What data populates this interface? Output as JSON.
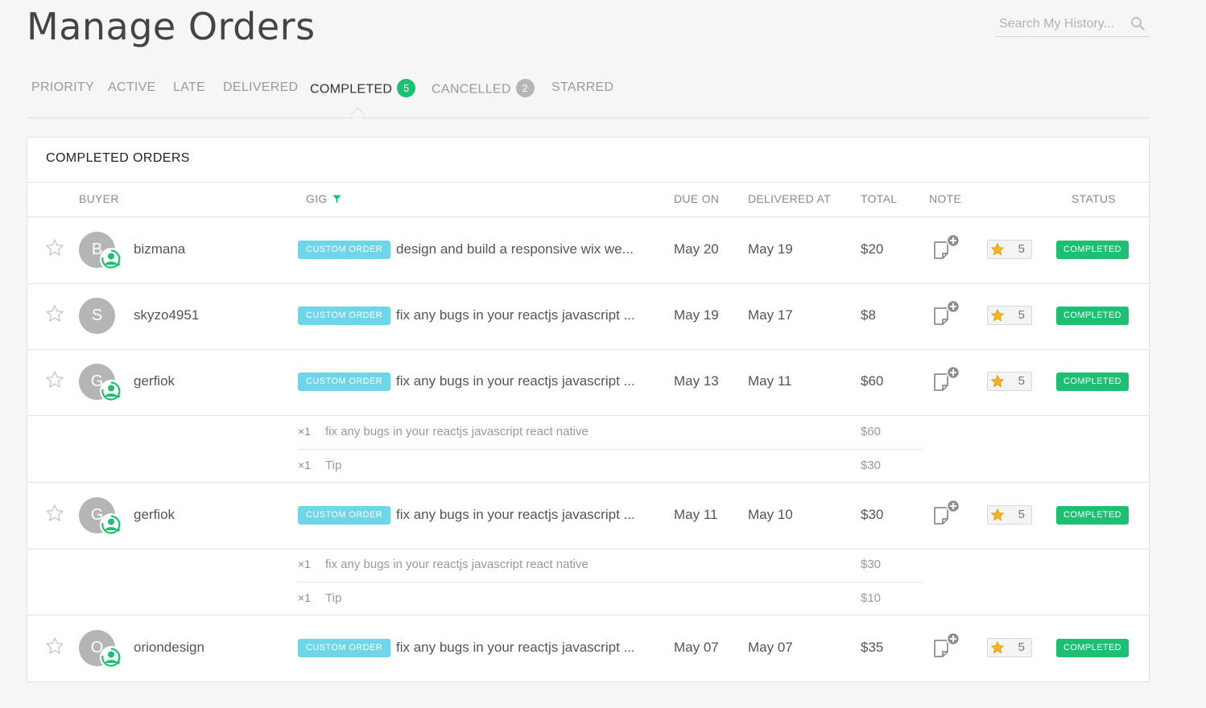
{
  "page": {
    "title": "Manage Orders"
  },
  "search": {
    "placeholder": "Search My History..."
  },
  "tabs": [
    {
      "label": "PRIORITY"
    },
    {
      "label": "ACTIVE"
    },
    {
      "label": "LATE"
    },
    {
      "label": "DELIVERED"
    },
    {
      "label": "COMPLETED",
      "badge": "5",
      "active": true
    },
    {
      "label": "CANCELLED",
      "badge": "2"
    },
    {
      "label": "STARRED"
    }
  ],
  "panel": {
    "title": "COMPLETED ORDERS",
    "columns": {
      "buyer": "BUYER",
      "gig": "GIG",
      "due_on": "DUE ON",
      "delivered_at": "DELIVERED AT",
      "total": "TOTAL",
      "note": "NOTE",
      "status": "STATUS"
    }
  },
  "orders": [
    {
      "avatar": "B",
      "buyer": "bizmana",
      "tag": "CUSTOM ORDER",
      "gig": "design and build a responsive wix we...",
      "due": "May 20",
      "delivered": "May 19",
      "total": "$20",
      "rating": "5",
      "status": "COMPLETED"
    },
    {
      "avatar": "S",
      "buyer": "skyzo4951",
      "tag": "CUSTOM ORDER",
      "gig": "fix any bugs in your reactjs javascript ...",
      "due": "May 19",
      "delivered": "May 17",
      "total": "$8",
      "rating": "5",
      "status": "COMPLETED"
    },
    {
      "avatar": "G",
      "buyer": "gerfiok",
      "tag": "CUSTOM ORDER",
      "gig": "fix any bugs in your reactjs javascript ...",
      "due": "May 13",
      "delivered": "May 11",
      "total": "$60",
      "rating": "5",
      "status": "COMPLETED",
      "lines": [
        {
          "qty": "×1",
          "desc": "fix any bugs in your reactjs javascript react native",
          "price": "$60"
        },
        {
          "qty": "×1",
          "desc": "Tip",
          "price": "$30"
        }
      ]
    },
    {
      "avatar": "G",
      "buyer": "gerfiok",
      "tag": "CUSTOM ORDER",
      "gig": "fix any bugs in your reactjs javascript ...",
      "due": "May 11",
      "delivered": "May 10",
      "total": "$30",
      "rating": "5",
      "status": "COMPLETED",
      "lines": [
        {
          "qty": "×1",
          "desc": "fix any bugs in your reactjs javascript react native",
          "price": "$30"
        },
        {
          "qty": "×1",
          "desc": "Tip",
          "price": "$10"
        }
      ]
    },
    {
      "avatar": "O",
      "buyer": "oriondesign",
      "tag": "CUSTOM ORDER",
      "gig": "fix any bugs in your reactjs javascript ...",
      "due": "May 07",
      "delivered": "May 07",
      "total": "$35",
      "rating": "5",
      "status": "COMPLETED"
    }
  ],
  "colors": {
    "accent_green": "#1dbf73",
    "custom_tag": "#6fd5e9",
    "avatar_gray": "#b5b5b5",
    "rating_star": "#f2b51d"
  },
  "icons": {
    "search": "search-icon",
    "gig_filter": "filter-icon",
    "star": "star-outline-icon",
    "repeat_buyer": "repeat-buyer-icon",
    "note": "add-note-icon",
    "rating": "rating-star-icon"
  }
}
